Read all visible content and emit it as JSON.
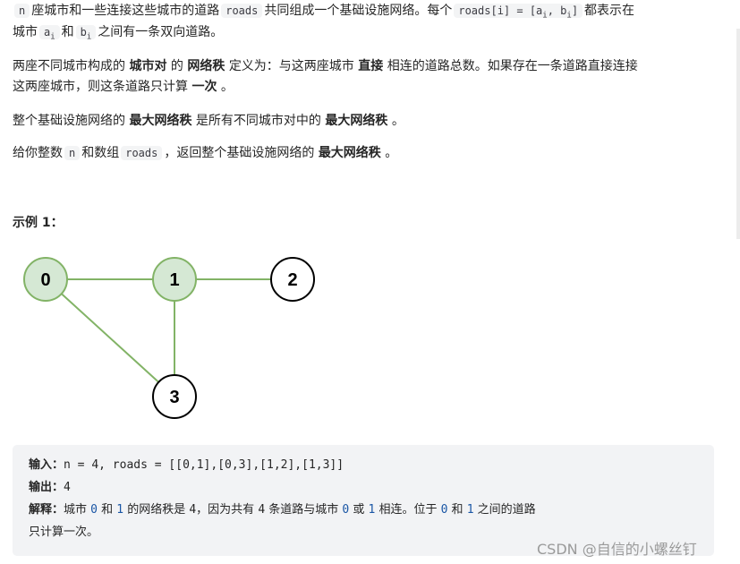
{
  "description": {
    "p1": {
      "code_n": "n",
      "t1": "座城市和一些连接这些城市的道路",
      "code_roads": "roads",
      "t2": "共同组成一个基础设施网络。每个",
      "code_roads_i_prefix": "roads[i] = [a",
      "code_sub_i1": "i",
      "code_mid": ", b",
      "code_sub_i2": "i",
      "code_suffix": "]",
      "t3": "都表示在",
      "line2_t1": "城市",
      "code_a": "a",
      "code_a_sub": "i",
      "line2_t2": "和",
      "code_b": "b",
      "code_b_sub": "i",
      "line2_t3": "之间有一条双向道路。"
    },
    "p2": {
      "t1": "两座不同城市构成的",
      "b1": "城市对",
      "t2": "的",
      "b2": "网络秩",
      "t3": "定义为：与这两座城市",
      "b3": "直接",
      "t4": "相连的道路总数。如果存在一条道路直接连接",
      "line2_t1": "这两座城市，则这条道路只计算",
      "b4": "一次",
      "line2_t2": "。"
    },
    "p3": {
      "t1": "整个基础设施网络的",
      "b1": "最大网络秩",
      "t2": "是所有不同城市对中的",
      "b2": "最大网络秩",
      "t3": "。"
    },
    "p4": {
      "t1": "给你整数",
      "code_n": "n",
      "t2": "和数组",
      "code_roads": "roads",
      "t3": "，返回整个基础设施网络的",
      "b1": "最大网络秩",
      "t4": "。"
    }
  },
  "example": {
    "title": "示例 1：",
    "graph": {
      "nodes": [
        {
          "id": "0",
          "highlighted": true
        },
        {
          "id": "1",
          "highlighted": true
        },
        {
          "id": "2",
          "highlighted": false
        },
        {
          "id": "3",
          "highlighted": false
        }
      ],
      "edges": [
        [
          "0",
          "1"
        ],
        [
          "1",
          "2"
        ],
        [
          "0",
          "3"
        ],
        [
          "1",
          "3"
        ]
      ],
      "colors": {
        "highlight_fill": "#d5e8d4",
        "highlight_stroke": "#82b366",
        "edge": "#82b366",
        "normal_stroke": "#000000"
      }
    },
    "input_label": "输入：",
    "input_value": "n = 4, roads = [[0,1],[0,3],[1,2],[1,3]]",
    "output_label": "输出：",
    "output_value": "4",
    "explain_label": "解释：",
    "explain": {
      "a": "城市 ",
      "n0": "0",
      "b": " 和 ",
      "n1": "1",
      "c": " 的网络秩是 ",
      "n4a": "4",
      "d": "，因为共有 ",
      "n4b": "4",
      "e": " 条道路与城市 ",
      "n0b": "0",
      "f": " 或 ",
      "n1b": "1",
      "g": " 相连。位于 ",
      "n0c": "0",
      "h": " 和 ",
      "n1c": "1",
      "i": " 之间的道路",
      "line2": "只计算一次。"
    }
  },
  "watermark": "CSDN @自信的小螺丝钉"
}
